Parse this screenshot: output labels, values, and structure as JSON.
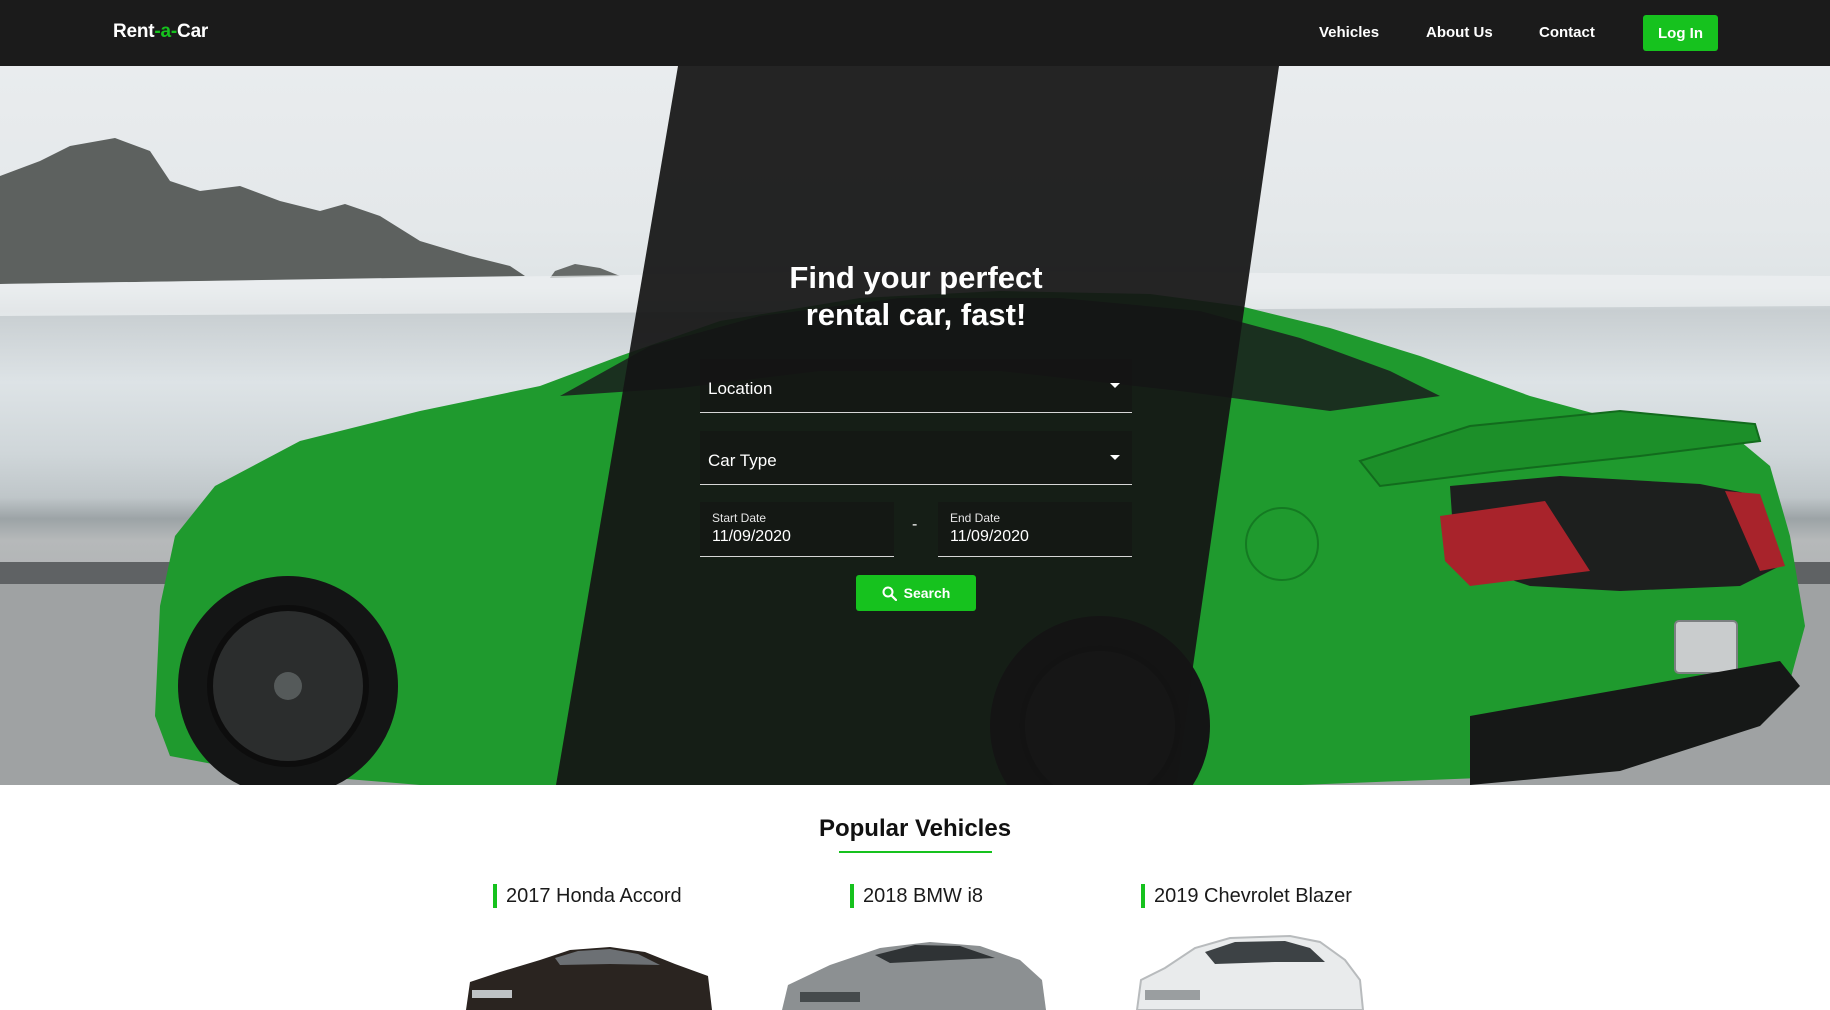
{
  "navbar": {
    "logo": {
      "left": "Rent",
      "middle": "-a-",
      "right": "Car"
    },
    "links": [
      "Vehicles",
      "About Us",
      "Contact"
    ],
    "login_label": "Log In"
  },
  "hero": {
    "title_line1": "Find your perfect",
    "title_line2": "rental car, fast!",
    "location_placeholder": "Location",
    "car_type_placeholder": "Car Type",
    "start_date_label": "Start Date",
    "start_date_value": "11/09/2020",
    "date_separator": "-",
    "end_date_label": "End Date",
    "end_date_value": "11/09/2020",
    "search_label": "Search"
  },
  "popular": {
    "title": "Popular Vehicles",
    "vehicles": [
      {
        "name": "2017 Honda Accord"
      },
      {
        "name": "2018 BMW i8"
      },
      {
        "name": "2019 Chevrolet Blazer"
      }
    ]
  },
  "colors": {
    "accent": "#16c21e",
    "navbar": "#1b1b1b",
    "car": "#1f9a2e"
  },
  "icons": {
    "search": "search-icon",
    "dropdown": "caret-down-icon"
  }
}
